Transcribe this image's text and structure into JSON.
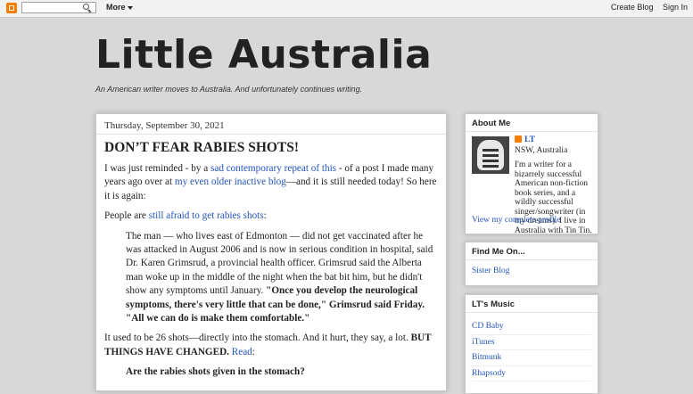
{
  "navbar": {
    "more_label": "More",
    "create_blog": "Create Blog",
    "sign_in": "Sign In",
    "search_placeholder": ""
  },
  "blog": {
    "title": "Little Australia",
    "description": "An American writer moves to Australia. And unfortunately continues writing."
  },
  "post": {
    "date": "Thursday, September 30, 2021",
    "title": "DON’T FEAR RABIES SHOTS!",
    "p1_a": "I was just reminded - by a ",
    "p1_link1": "sad contemporary repeat of this",
    "p1_b": " - of a post I made many years ago over at ",
    "p1_link2": "my even older inactive blog",
    "p1_c": "—and it is still needed today! So here it is again:",
    "p2_a": "People are ",
    "p2_link": "still afraid to get rabies shots",
    "p2_b": ":",
    "quote_a": "The man — who lives east of Edmonton — did not get vaccinated after he was attacked in August 2006 and is now in serious condition in hospital, said Dr. Karen Grimsrud, a provincial health officer. Grimsrud said the Alberta man woke up in the middle of the night when the bat bit him, but he didn't show any symptoms until January. ",
    "quote_bold": "\"Once you develop the neurological symptoms, there's very little that can be done,\" Grimsrud said Friday. \"All we can do is make them comfortable.\"",
    "p3_a": "It used to be 26 shots—directly into the stomach. And it hurt, they say, a lot. ",
    "p3_bold": "BUT THINGS HAVE CHANGED.",
    "p3_link": "Read",
    "p3_b": ":",
    "question": "Are the rabies shots given in the stomach?"
  },
  "sidebar": {
    "about": {
      "title": "About Me",
      "name": "LT",
      "location": "NSW, Australia",
      "bio": "I'm a writer for a bizarrely successful American non-fiction book series, and a wildly successful singer/songwriter (in my dreams). I live in Australia with Tin Tin.",
      "profile_link": "View my complete profile"
    },
    "find_me": {
      "title": "Find Me On...",
      "link": "Sister Blog"
    },
    "music": {
      "title": "LT's Music",
      "items": [
        "CD Baby",
        "iTunes",
        "Bitmunk",
        "Rhapsody"
      ]
    }
  }
}
